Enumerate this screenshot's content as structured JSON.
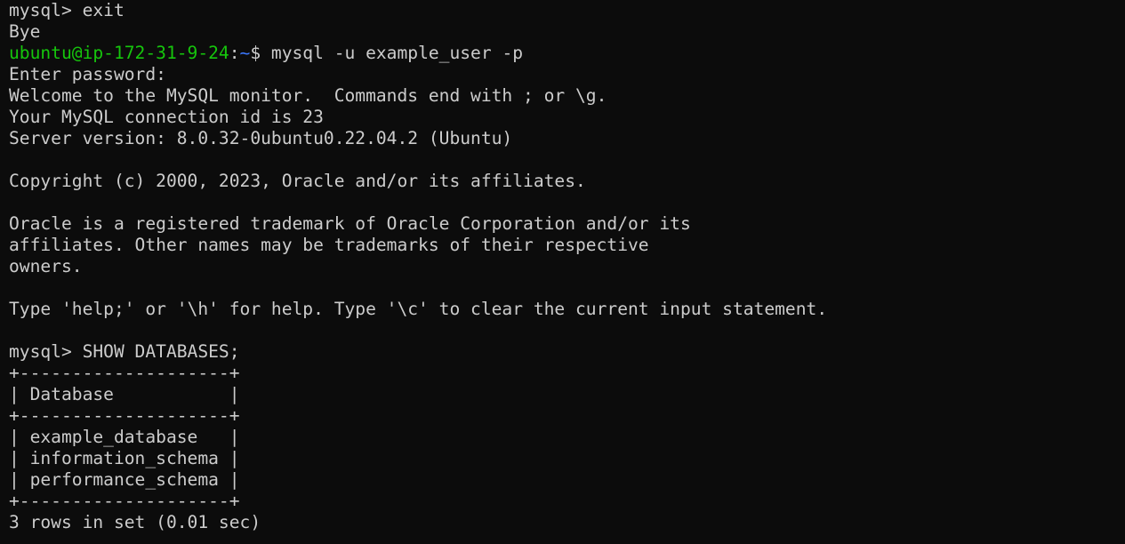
{
  "colors": {
    "background": "#0c0c0c",
    "foreground": "#cccccc",
    "prompt_user": "#16c60c",
    "prompt_path": "#3b78ff"
  },
  "terminal": {
    "lines": [
      {
        "kind": "text",
        "text": "mysql> exit"
      },
      {
        "kind": "text",
        "text": "Bye"
      },
      {
        "kind": "prompt",
        "user_host": "ubuntu@ip-172-31-9-24",
        "colon": ":",
        "path": "~",
        "dollar": "$",
        "command": " mysql -u example_user -p"
      },
      {
        "kind": "text",
        "text": "Enter password:"
      },
      {
        "kind": "text",
        "text": "Welcome to the MySQL monitor.  Commands end with ; or \\g."
      },
      {
        "kind": "text",
        "text": "Your MySQL connection id is 23"
      },
      {
        "kind": "text",
        "text": "Server version: 8.0.32-0ubuntu0.22.04.2 (Ubuntu)"
      },
      {
        "kind": "text",
        "text": ""
      },
      {
        "kind": "text",
        "text": "Copyright (c) 2000, 2023, Oracle and/or its affiliates."
      },
      {
        "kind": "text",
        "text": ""
      },
      {
        "kind": "text",
        "text": "Oracle is a registered trademark of Oracle Corporation and/or its"
      },
      {
        "kind": "text",
        "text": "affiliates. Other names may be trademarks of their respective"
      },
      {
        "kind": "text",
        "text": "owners."
      },
      {
        "kind": "text",
        "text": ""
      },
      {
        "kind": "text",
        "text": "Type 'help;' or '\\h' for help. Type '\\c' to clear the current input statement."
      },
      {
        "kind": "text",
        "text": ""
      },
      {
        "kind": "text",
        "text": "mysql> SHOW DATABASES;"
      },
      {
        "kind": "text",
        "text": "+--------------------+"
      },
      {
        "kind": "text",
        "text": "| Database           |"
      },
      {
        "kind": "text",
        "text": "+--------------------+"
      },
      {
        "kind": "text",
        "text": "| example_database   |"
      },
      {
        "kind": "text",
        "text": "| information_schema |"
      },
      {
        "kind": "text",
        "text": "| performance_schema |"
      },
      {
        "kind": "text",
        "text": "+--------------------+"
      },
      {
        "kind": "text",
        "text": "3 rows in set (0.01 sec)"
      }
    ]
  }
}
